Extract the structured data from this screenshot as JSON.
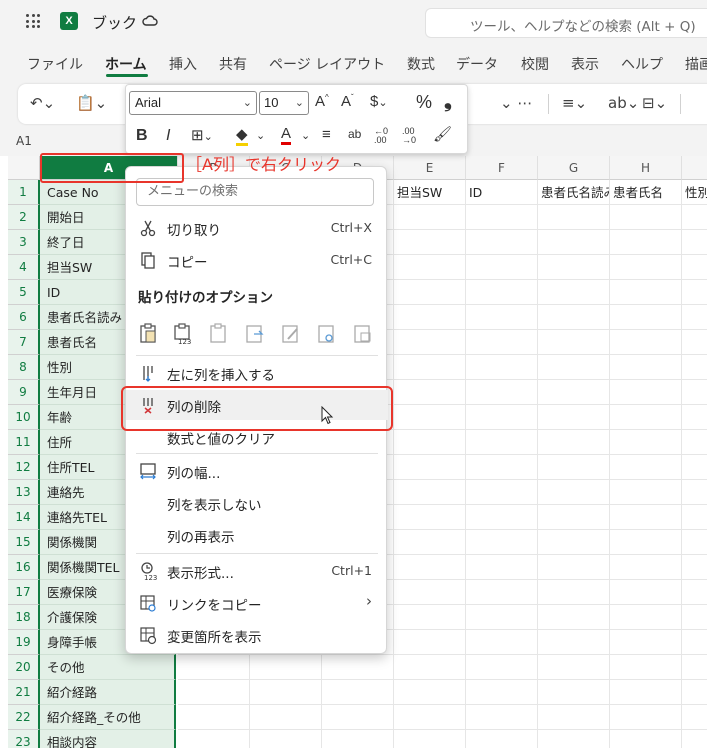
{
  "app": {
    "doc_title": "ブック",
    "search_placeholder": "ツール、ヘルプなどの検索 (Alt + Q)"
  },
  "tabs": [
    "ファイル",
    "ホーム",
    "挿入",
    "共有",
    "ページ レイアウト",
    "数式",
    "データ",
    "校閲",
    "表示",
    "ヘルプ",
    "描画"
  ],
  "active_tab": "ホーム",
  "name_box": "A1",
  "mini_toolbar": {
    "font": "Arial",
    "size": "10",
    "dollar": "$",
    "percent": "%",
    "comma": "❟"
  },
  "columns": [
    "A",
    "B",
    "C",
    "D",
    "E",
    "F",
    "G",
    "H",
    ""
  ],
  "header_row": {
    "E": "担当SW",
    "F": "ID",
    "G": "患者氏名読み",
    "H": "患者氏名",
    "I": "性別"
  },
  "rows": [
    {
      "n": "1",
      "a": "Case No"
    },
    {
      "n": "2",
      "a": "開始日"
    },
    {
      "n": "3",
      "a": "終了日"
    },
    {
      "n": "4",
      "a": "担当SW"
    },
    {
      "n": "5",
      "a": "ID"
    },
    {
      "n": "6",
      "a": "患者氏名読み"
    },
    {
      "n": "7",
      "a": "患者氏名"
    },
    {
      "n": "8",
      "a": "性別"
    },
    {
      "n": "9",
      "a": "生年月日"
    },
    {
      "n": "10",
      "a": "年齢"
    },
    {
      "n": "11",
      "a": "住所"
    },
    {
      "n": "12",
      "a": "住所TEL"
    },
    {
      "n": "13",
      "a": "連絡先"
    },
    {
      "n": "14",
      "a": "連絡先TEL"
    },
    {
      "n": "15",
      "a": "関係機関"
    },
    {
      "n": "16",
      "a": "関係機関TEL"
    },
    {
      "n": "17",
      "a": "医療保険"
    },
    {
      "n": "18",
      "a": "介護保険"
    },
    {
      "n": "19",
      "a": "身障手帳"
    },
    {
      "n": "20",
      "a": "その他"
    },
    {
      "n": "21",
      "a": "紹介経路"
    },
    {
      "n": "22",
      "a": "紹介経路_その他"
    },
    {
      "n": "23",
      "a": "相談内容"
    }
  ],
  "callout": "［A列］で右クリック",
  "context_menu": {
    "search_placeholder": "メニューの検索",
    "cut": "切り取り",
    "cut_sc": "Ctrl+X",
    "copy": "コピー",
    "copy_sc": "Ctrl+C",
    "paste_options": "貼り付けのオプション",
    "insert_left": "左に列を挿入する",
    "delete_col": "列の削除",
    "clear": "数式と値のクリア",
    "col_width": "列の幅...",
    "hide": "列を表示しない",
    "unhide": "列の再表示",
    "format": "表示形式...",
    "format_sc": "Ctrl+1",
    "copy_link": "リンクをコピー",
    "show_changes": "変更箇所を表示"
  },
  "colors": {
    "excel_green": "#107c41",
    "annotation_red": "#e8352b"
  }
}
